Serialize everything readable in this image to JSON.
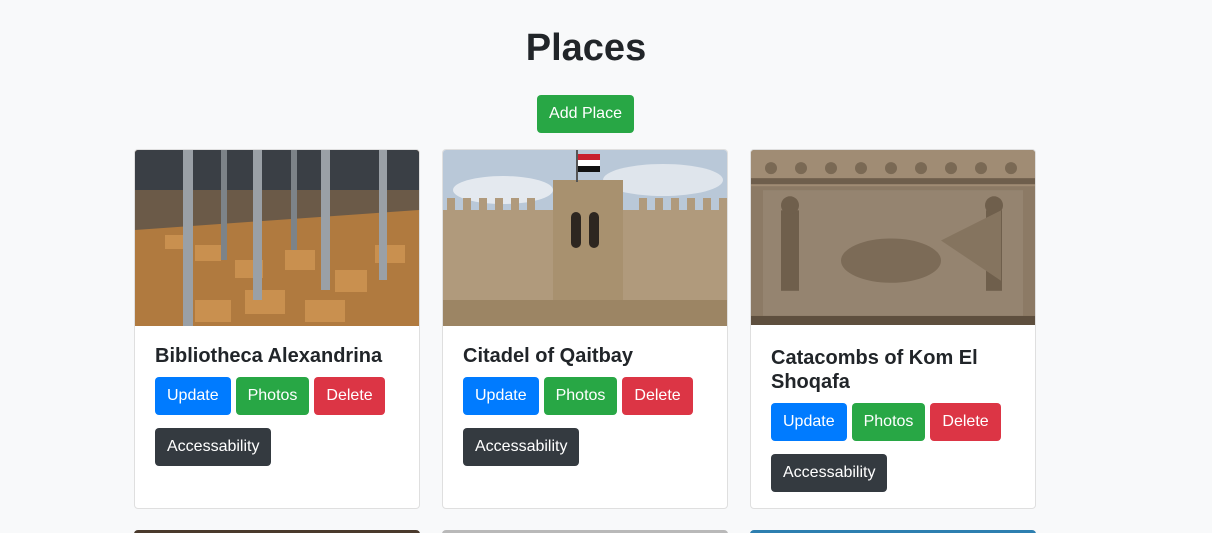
{
  "page": {
    "title": "Places",
    "add_button": "Add Place"
  },
  "places": [
    {
      "name": "Bibliotheca Alexandrina",
      "buttons": {
        "update": "Update",
        "photos": "Photos",
        "delete": "Delete",
        "accessability": "Accessability"
      }
    },
    {
      "name": "Citadel of Qaitbay",
      "buttons": {
        "update": "Update",
        "photos": "Photos",
        "delete": "Delete",
        "accessability": "Accessability"
      }
    },
    {
      "name": "Catacombs of Kom El Shoqafa",
      "buttons": {
        "update": "Update",
        "photos": "Photos",
        "delete": "Delete",
        "accessability": "Accessability"
      }
    }
  ],
  "colors": {
    "primary": "#007bff",
    "success": "#28a745",
    "danger": "#dc3545",
    "dark": "#343a40",
    "background": "#f8f9fa"
  }
}
